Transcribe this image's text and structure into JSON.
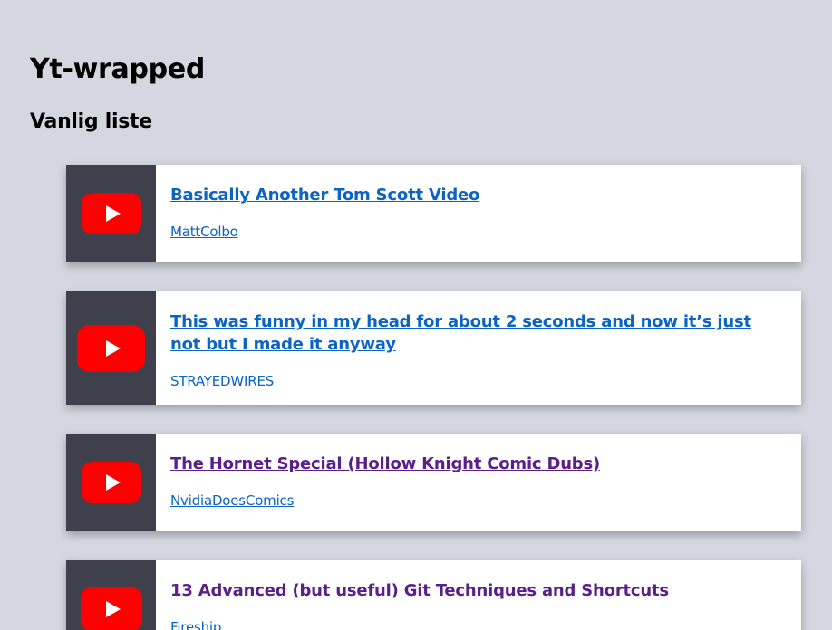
{
  "page": {
    "title": "Yt-wrapped",
    "subtitle": "Vanlig liste"
  },
  "videos": [
    {
      "title": "Basically Another Tom Scott Video",
      "channel": "MattColbo",
      "visited": false
    },
    {
      "title": "This was funny in my head for about 2 seconds and now it’s just not but I made it anyway",
      "channel": "STRAYEDWIRES",
      "visited": false
    },
    {
      "title": "The Hornet Special (Hollow Knight Comic Dubs)",
      "channel": "NvidiaDoesComics",
      "visited": true
    },
    {
      "title": "13 Advanced (but useful) Git Techniques and Shortcuts",
      "channel": "Fireship",
      "visited": true
    }
  ],
  "icons": {
    "thumbnail": "youtube-play-icon"
  },
  "colors": {
    "background": "#d4d7df",
    "link": "#0b63c4",
    "visited_link": "#5a1f8a",
    "thumbnail_bg": "#403f4c",
    "youtube_red": "#ff0000"
  }
}
